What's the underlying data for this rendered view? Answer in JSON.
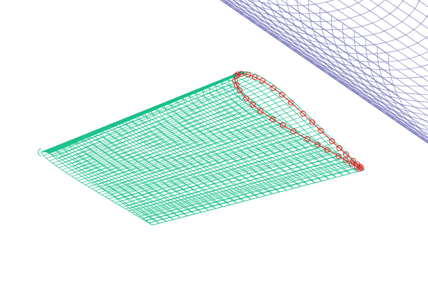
{
  "scene": {
    "background": "#ffffff",
    "fuselage": {
      "kind": "wireframe-cylinder",
      "color": "#7f7fc0",
      "rings": 26,
      "longitudinals": 30
    },
    "wing": {
      "kind": "wireframe-wing",
      "color": "#16c08a",
      "chordwise": 34,
      "spanwise": 30
    },
    "intersection": {
      "kind": "intersection-points",
      "color": "#dd2222",
      "points": 36
    }
  }
}
